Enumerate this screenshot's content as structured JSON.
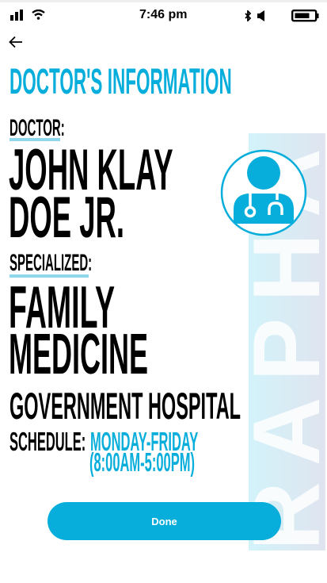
{
  "status_bar": {
    "time": "7:46 pm",
    "icons": [
      "signal-icon",
      "wifi-icon",
      "bluetooth-icon",
      "volume-icon",
      "battery-icon"
    ]
  },
  "nav": {
    "back_icon": "arrow-left-icon"
  },
  "title": "DOCTOR'S INFORMATION",
  "doctor": {
    "label": "DOCTOR:",
    "name_line1": "JOHN KLAY",
    "name_line2": "DOE JR.",
    "avatar_icon": "doctor-icon"
  },
  "specialization": {
    "label": "SPECIALIZED:",
    "line1": "FAMILY",
    "line2": "MEDICINE"
  },
  "hospital": "GOVERNMENT HOSPITAL",
  "schedule": {
    "label": "SCHEDULE:",
    "days": "MONDAY-FRIDAY",
    "hours": "(8:00AM-5:00PM)"
  },
  "done_label": "Done",
  "watermark": "RAPHA",
  "colors": {
    "accent": "#08aedb",
    "underline": "#8fd8ec"
  }
}
